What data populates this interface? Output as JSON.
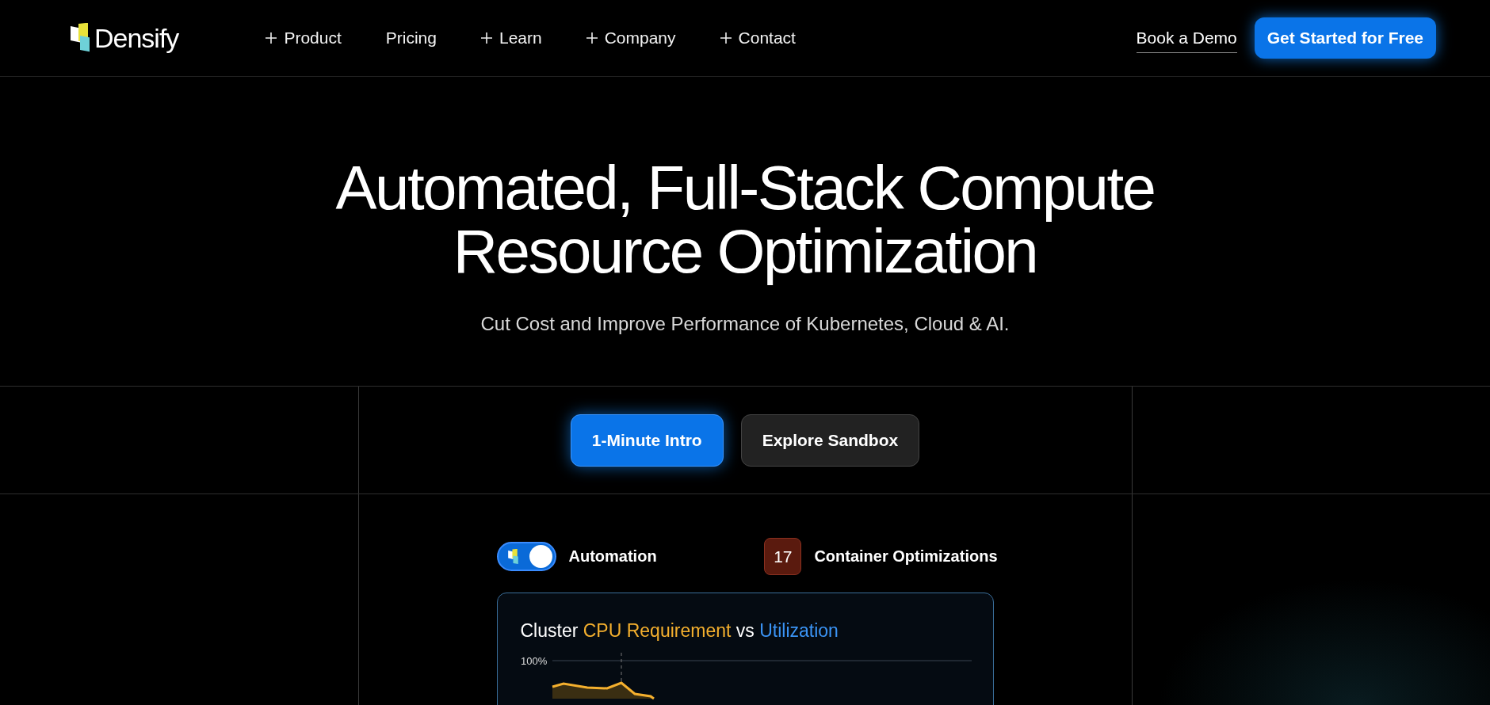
{
  "header": {
    "logo": "Densify",
    "nav": [
      {
        "label": "Product",
        "expandable": true
      },
      {
        "label": "Pricing",
        "expandable": false
      },
      {
        "label": "Learn",
        "expandable": true
      },
      {
        "label": "Company",
        "expandable": true
      },
      {
        "label": "Contact",
        "expandable": true
      }
    ],
    "book_demo": "Book a Demo",
    "cta": "Get Started for Free"
  },
  "hero": {
    "title_lines": [
      "Automated, Full-Stack Compute",
      "Resource Optimization"
    ],
    "subtitle": "Cut Cost and Improve Performance of Kubernetes, Cloud & AI."
  },
  "actions": [
    {
      "label": "1-Minute Intro",
      "kind": "primary"
    },
    {
      "label": "Explore Sandbox",
      "kind": "secondary"
    }
  ],
  "automation": {
    "label": "Automation",
    "on": true
  },
  "optimizations": {
    "count": "17",
    "label": "Container Optimizations"
  },
  "chart_card": {
    "title_parts": [
      {
        "text": "Cluster",
        "kind": "plain"
      },
      {
        "text": "CPU Requirement",
        "kind": "requirement"
      },
      {
        "text": "vs",
        "kind": "plain"
      },
      {
        "text": "Utilization",
        "kind": "utilization"
      }
    ],
    "y_label": "100%"
  }
}
